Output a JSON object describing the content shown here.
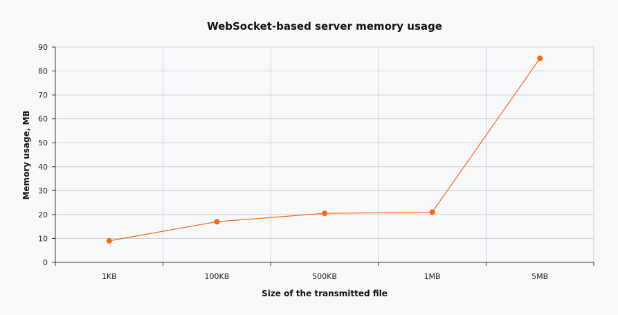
{
  "chart_data": {
    "type": "line",
    "title": "WebSocket-based server memory usage",
    "xlabel": "Size of the transmitted file",
    "ylabel": "Memory usage, MB",
    "categories": [
      "1KB",
      "100KB",
      "500KB",
      "1MB",
      "5MB"
    ],
    "series": [
      {
        "values": [
          9,
          17,
          20.5,
          21,
          85.3
        ],
        "color": "#f26b12"
      }
    ],
    "ylim": [
      0,
      90
    ],
    "yticks": [
      0,
      10,
      20,
      30,
      40,
      50,
      60,
      70,
      80,
      90
    ],
    "grid": true,
    "legend": "none"
  },
  "colors": {
    "background": "#f8f9fb",
    "grid": "#cfd2d6",
    "axis": "#333333",
    "series": "#f26b12"
  }
}
